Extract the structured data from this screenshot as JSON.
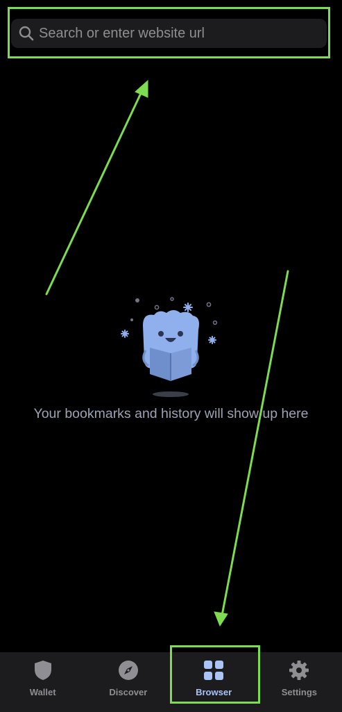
{
  "search": {
    "placeholder": "Search or enter website url",
    "value": ""
  },
  "empty_state": {
    "message": "Your bookmarks and history will show up here"
  },
  "tabs": [
    {
      "label": "Wallet",
      "icon": "shield-icon",
      "active": false
    },
    {
      "label": "Discover",
      "icon": "compass-icon",
      "active": false
    },
    {
      "label": "Browser",
      "icon": "grid-icon",
      "active": true
    },
    {
      "label": "Settings",
      "icon": "gear-icon",
      "active": false
    }
  ],
  "colors": {
    "annotation": "#7ddc4f",
    "accent": "#a9c4f5",
    "tab_bar": "#1c1c1e",
    "inactive": "#8e8e93"
  }
}
